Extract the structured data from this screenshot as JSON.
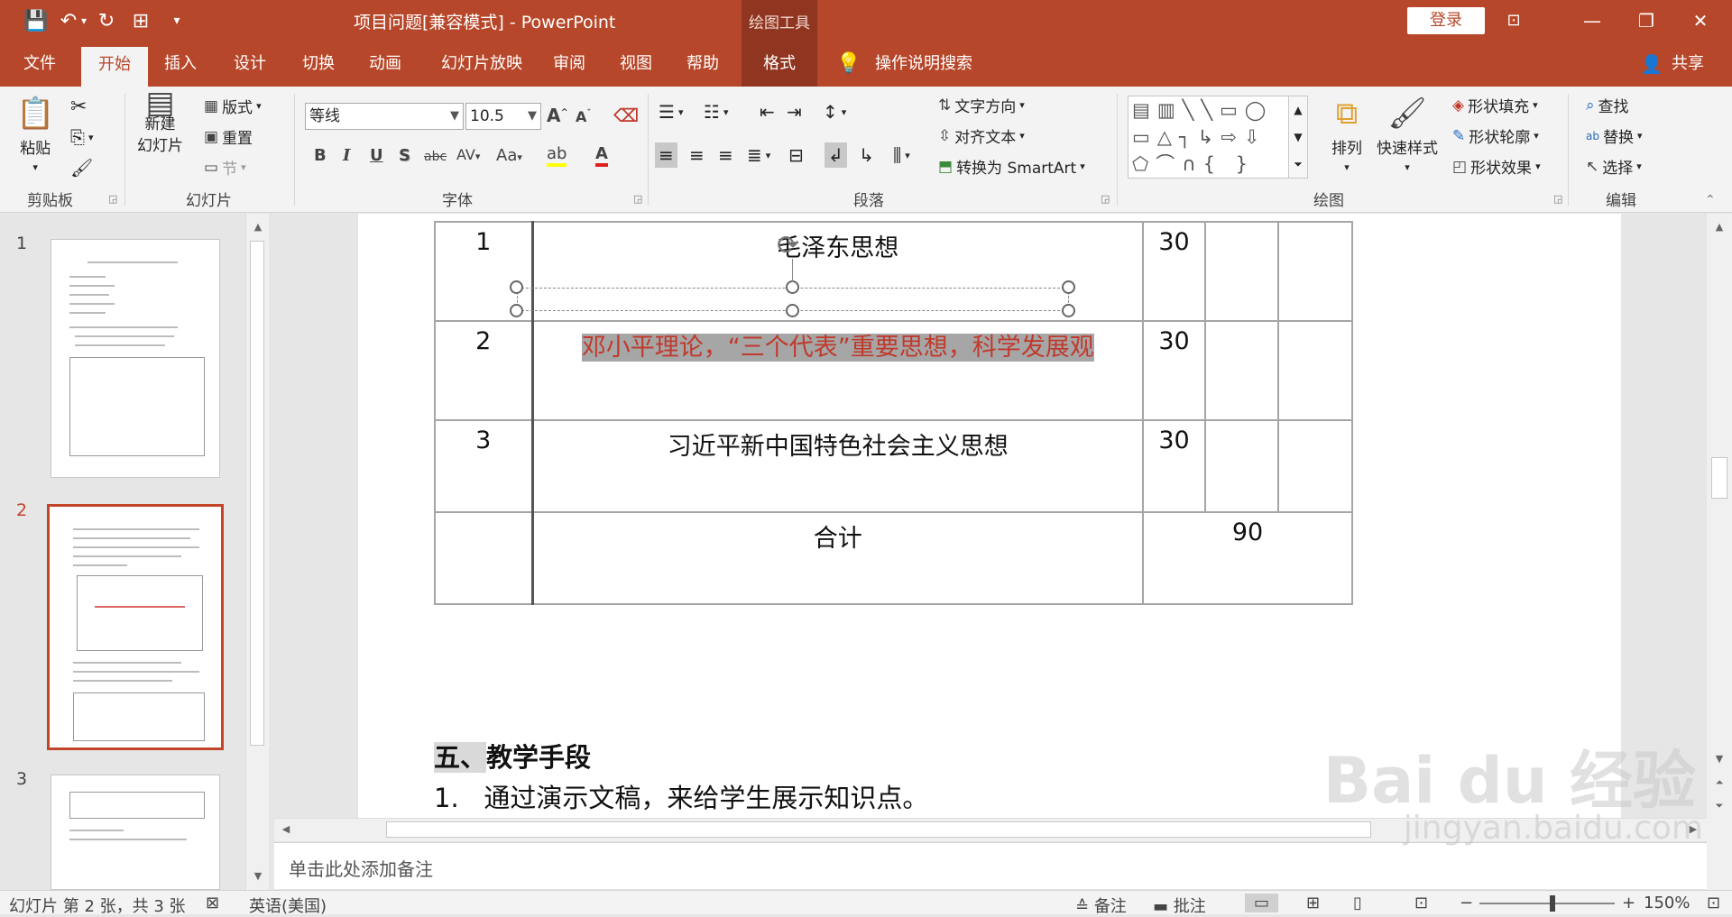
{
  "window": {
    "title": "项目问题[兼容模式] - PowerPoint",
    "context_tools": "绘图工具",
    "login": "登录",
    "minimize": "—",
    "restore": "❐",
    "close": "✕",
    "ribbon_display": "⊡"
  },
  "qat": {
    "save": "💾",
    "undo": "↶",
    "redo": "↻",
    "present": "⊞",
    "more": "▾"
  },
  "tabs": [
    "文件",
    "开始",
    "插入",
    "设计",
    "切换",
    "动画",
    "幻灯片放映",
    "审阅",
    "视图",
    "帮助",
    "格式"
  ],
  "search": {
    "label": "操作说明搜索"
  },
  "share": "共享",
  "ribbon": {
    "clipboard": {
      "paste": "粘贴",
      "group": "剪贴板"
    },
    "slides": {
      "new_slide_1": "新建",
      "new_slide_2": "幻灯片",
      "layout": "版式",
      "reset": "重置",
      "section": "节",
      "group": "幻灯片"
    },
    "font": {
      "name": "等线",
      "size": "10.5",
      "group": "字体",
      "bold": "B",
      "italic": "I",
      "underline": "U",
      "shadow": "S",
      "strike": "abc",
      "spacing": "AV",
      "case": "Aa",
      "grow": "A",
      "shrink": "A"
    },
    "paragraph": {
      "text_direction": "文字方向",
      "align_text": "对齐文本",
      "smartart": "转换为 SmartArt",
      "group": "段落"
    },
    "drawing": {
      "arrange": "排列",
      "quick_styles": "快速样式",
      "fill": "形状填充",
      "outline": "形状轮廓",
      "effects": "形状效果",
      "group": "绘图"
    },
    "editing": {
      "find": "查找",
      "replace": "替换",
      "select": "选择",
      "group": "编辑"
    }
  },
  "thumbnails": [
    {
      "num": "1"
    },
    {
      "num": "2"
    },
    {
      "num": "3"
    }
  ],
  "table": {
    "rows": [
      {
        "no": "1",
        "name": "毛泽东思想",
        "hours": "30"
      },
      {
        "no": "2",
        "name": "邓小平理论，“三个代表”重要思想，科学发展观",
        "hours": "30"
      },
      {
        "no": "3",
        "name": "习近平新中国特色社会主义思想",
        "hours": "30"
      }
    ],
    "total_label": "合计",
    "total_value": "90"
  },
  "section": {
    "num": "五、",
    "title": "教学手段"
  },
  "list_item": {
    "num": "1.",
    "text": "通过演示文稿，来给学生展示知识点。"
  },
  "notes": {
    "placeholder": "单击此处添加备注"
  },
  "status": {
    "slide_info": "幻灯片 第 2 张，共 3 张",
    "language": "英语(美国)",
    "notes": "备注",
    "comments": "批注",
    "zoom": "150%"
  },
  "watermark": {
    "logo": "Bai du 经验",
    "url": "jingyan.baidu.com"
  }
}
